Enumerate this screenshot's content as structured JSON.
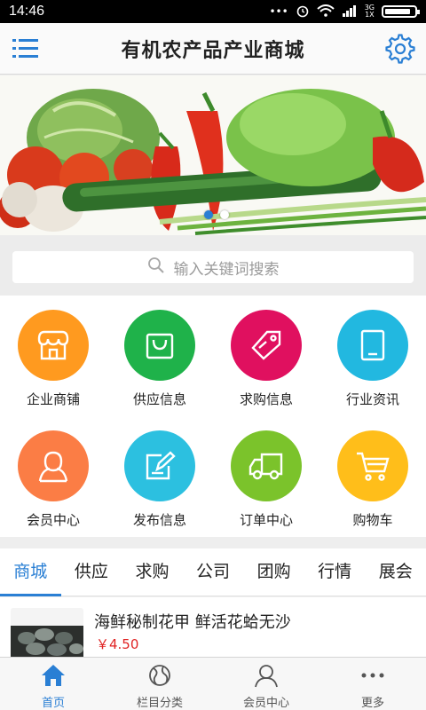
{
  "status_bar": {
    "time": "14:46",
    "network": "3G",
    "network_sub": "1X"
  },
  "header": {
    "title": "有机农产品产业商城",
    "menu_icon": "hamburger-menu-icon",
    "settings_icon": "gear-icon"
  },
  "banner": {
    "slide_count": 2,
    "active_slide": 1
  },
  "search": {
    "placeholder": "输入关键词搜索"
  },
  "grid": {
    "items": [
      {
        "label": "企业商铺",
        "icon": "store-icon",
        "color": "#ff9a1f"
      },
      {
        "label": "供应信息",
        "icon": "shopping-bag-icon",
        "color": "#1fb24a"
      },
      {
        "label": "求购信息",
        "icon": "price-tag-icon",
        "color": "#e0105f"
      },
      {
        "label": "行业资讯",
        "icon": "tablet-icon",
        "color": "#22b8e0"
      },
      {
        "label": "会员中心",
        "icon": "user-icon",
        "color": "#fb7d45"
      },
      {
        "label": "发布信息",
        "icon": "edit-icon",
        "color": "#2cc0e0"
      },
      {
        "label": "订单中心",
        "icon": "truck-icon",
        "color": "#7bc32b"
      },
      {
        "label": "购物车",
        "icon": "shopping-cart-icon",
        "color": "#ffbe1a"
      }
    ]
  },
  "tabs": {
    "items": [
      "商城",
      "供应",
      "求购",
      "公司",
      "团购",
      "行情",
      "展会"
    ],
    "active": 0
  },
  "product": {
    "name": "海鲜秘制花甲 鲜活花蛤无沙",
    "price": "￥4.50"
  },
  "bottom_nav": {
    "items": [
      {
        "label": "首页",
        "icon": "home-icon"
      },
      {
        "label": "栏目分类",
        "icon": "category-globe-icon"
      },
      {
        "label": "会员中心",
        "icon": "user-icon"
      },
      {
        "label": "更多",
        "icon": "more-dots-icon"
      }
    ],
    "active": 0
  },
  "colors": {
    "accent": "#2a7fd4",
    "price": "#e02323"
  }
}
